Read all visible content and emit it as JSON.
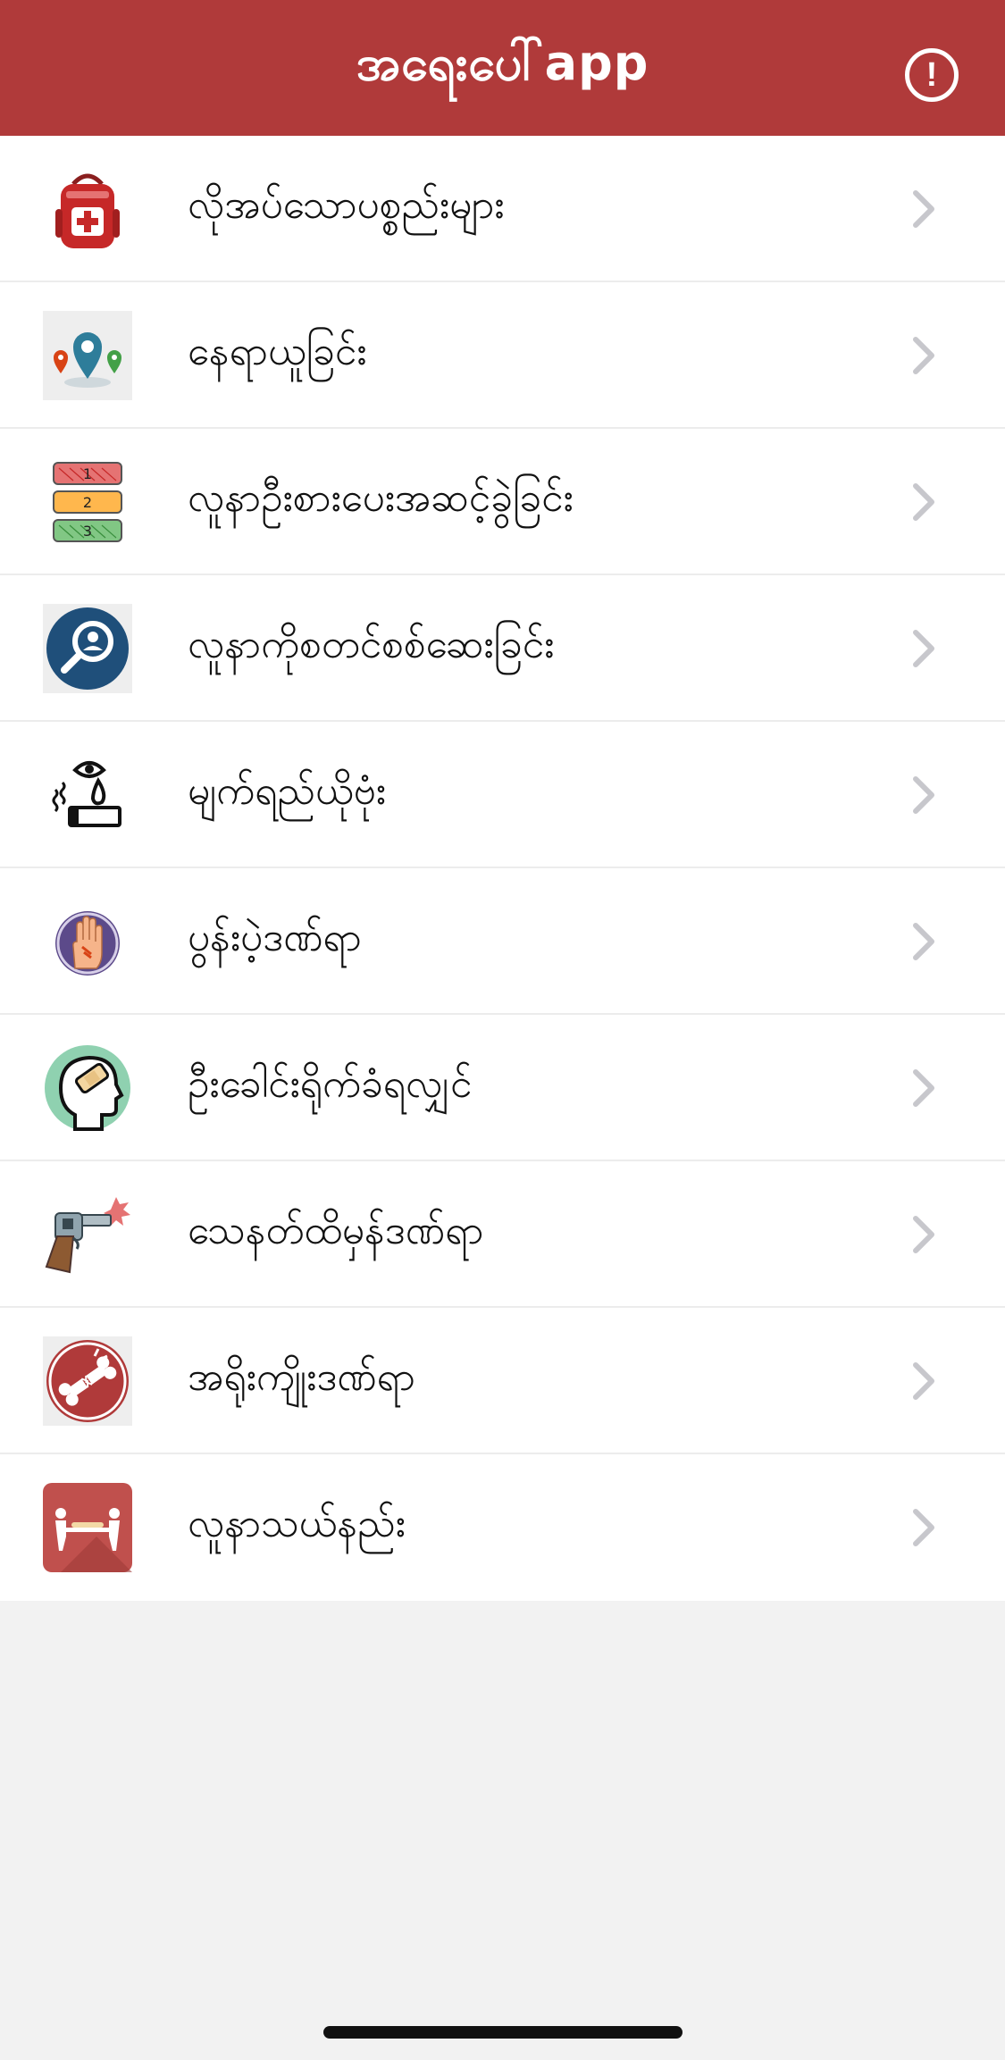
{
  "header": {
    "title": "အရေးပေါ်app",
    "info_symbol": "!"
  },
  "colors": {
    "brand": "#b03a3a",
    "background": "#f2f2f2",
    "row": "#ffffff",
    "chevron": "#c7c7cc"
  },
  "menu": {
    "items": [
      {
        "label": "လိုအပ်သောပစ္စည်းများ",
        "icon": "first-aid-backpack-icon"
      },
      {
        "label": "နေရာယူခြင်း",
        "icon": "location-pins-icon"
      },
      {
        "label": "လူနာဦးစားပေးအဆင့်ခွဲခြင်း",
        "icon": "triage-priority-icon"
      },
      {
        "label": "လူနာကိုစတင်စစ်ဆေးခြင်း",
        "icon": "patient-search-icon"
      },
      {
        "label": "မျက်ရည်ယိုဗုံး",
        "icon": "tear-gas-icon"
      },
      {
        "label": "ပွန်းပဲ့ဒဏ်ရာ",
        "icon": "hand-abrasion-icon"
      },
      {
        "label": "ဦးခေါင်းရိုက်ခံရလျှင်",
        "icon": "head-injury-icon"
      },
      {
        "label": "သေနတ်ထိမှန်ဒဏ်ရာ",
        "icon": "gunshot-icon"
      },
      {
        "label": "အရိုးကျိုးဒဏ်ရာ",
        "icon": "broken-bone-icon"
      },
      {
        "label": "လူနာသယ်နည်း",
        "icon": "stretcher-carry-icon"
      }
    ]
  }
}
